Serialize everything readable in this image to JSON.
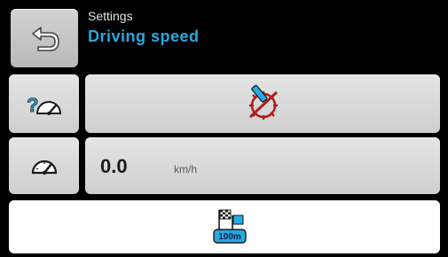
{
  "header": {
    "section_label": "Settings",
    "title": "Driving speed"
  },
  "speed": {
    "value": "0.0",
    "unit": "km/h"
  },
  "calibration": {
    "distance_badge": "100m"
  },
  "icons": {
    "back": "back-arrow-icon",
    "speed_source_help": "speedometer-question-icon",
    "speed_source_disabled": "speed-sensor-crossed-out-icon",
    "speedometer": "speedometer-icon",
    "calibration": "finish-flag-distance-icon"
  },
  "colors": {
    "accent_blue": "#28a8e0",
    "alert_red": "#b01c1c",
    "background": "#000000",
    "tile": "#d9d9d9"
  }
}
